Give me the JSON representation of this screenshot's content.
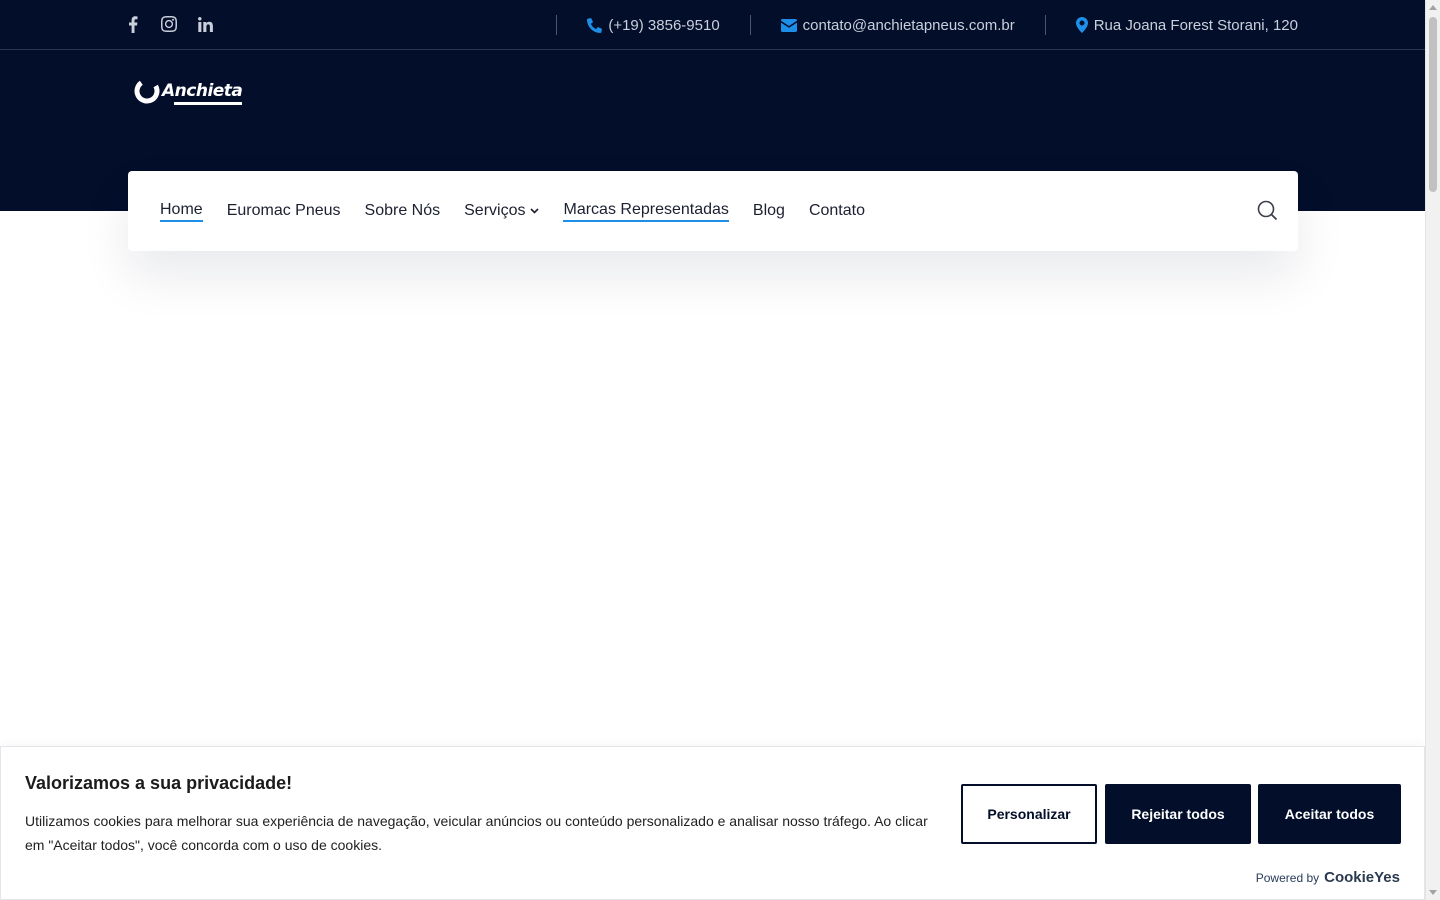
{
  "topbar": {
    "social": [
      {
        "icon": "facebook-icon"
      },
      {
        "icon": "instagram-icon"
      },
      {
        "icon": "linkedin-icon"
      }
    ],
    "phone": "(+19) 3856-9510",
    "email": "contato@anchietapneus.com.br",
    "address": "Rua Joana Forest Storani, 120"
  },
  "logo": {
    "text": "Anchieta",
    "tagline": "RECAUCHUTAGEM"
  },
  "nav": {
    "items": [
      {
        "label": "Home"
      },
      {
        "label": "Euromac Pneus"
      },
      {
        "label": "Sobre Nós"
      },
      {
        "label": "Serviços"
      },
      {
        "label": "Marcas Representadas"
      },
      {
        "label": "Blog"
      },
      {
        "label": "Contato"
      }
    ]
  },
  "cookie": {
    "title": "Valorizamos a sua privacidade!",
    "text": "Utilizamos cookies para melhorar sua experiência de navegação, veicular anúncios ou conteúdo personalizado e analisar nosso tráfego. Ao clicar em \"Aceitar todos\", você concorda com o uso de cookies.",
    "buttons": {
      "customize": "Personalizar",
      "reject": "Rejeitar todos",
      "accept": "Aceitar todos"
    },
    "powered_by": "Powered by",
    "brand": "CookieYes"
  },
  "colors": {
    "header_bg": "#020e2a",
    "accent": "#1e8fe8",
    "button_bg": "#020e2a"
  }
}
